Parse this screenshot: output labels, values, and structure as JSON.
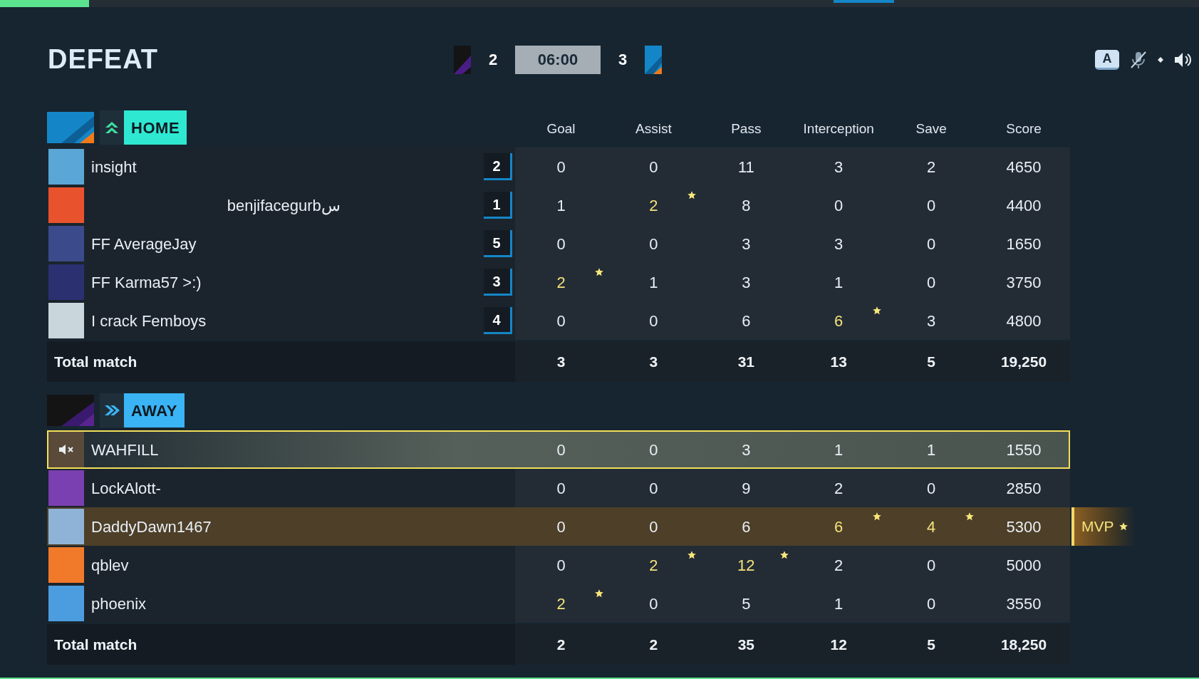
{
  "result": "DEFEAT",
  "scoreboard": {
    "left_score": "2",
    "timer": "06:00",
    "right_score": "3"
  },
  "keycap": "A",
  "columns": [
    "Goal",
    "Assist",
    "Pass",
    "Interception",
    "Save",
    "Score"
  ],
  "teams": [
    {
      "kind": "home",
      "label": "HOME",
      "players": [
        {
          "name": "insight",
          "name_centered": false,
          "badge": "2",
          "muted": false,
          "selected": false,
          "mvp": false,
          "stats": [
            {
              "value": "0",
              "best": false
            },
            {
              "value": "0",
              "best": false
            },
            {
              "value": "11",
              "best": false
            },
            {
              "value": "3",
              "best": false
            },
            {
              "value": "2",
              "best": false
            },
            {
              "value": "4650",
              "best": false
            }
          ]
        },
        {
          "name": "benjifacegurbس",
          "name_centered": true,
          "badge": "1",
          "muted": false,
          "selected": false,
          "mvp": false,
          "stats": [
            {
              "value": "1",
              "best": false
            },
            {
              "value": "2",
              "best": true
            },
            {
              "value": "8",
              "best": false
            },
            {
              "value": "0",
              "best": false
            },
            {
              "value": "0",
              "best": false
            },
            {
              "value": "4400",
              "best": false
            }
          ]
        },
        {
          "name": "FF AverageJay",
          "name_centered": false,
          "badge": "5",
          "muted": false,
          "selected": false,
          "mvp": false,
          "stats": [
            {
              "value": "0",
              "best": false
            },
            {
              "value": "0",
              "best": false
            },
            {
              "value": "3",
              "best": false
            },
            {
              "value": "3",
              "best": false
            },
            {
              "value": "0",
              "best": false
            },
            {
              "value": "1650",
              "best": false
            }
          ]
        },
        {
          "name": "FF Karma57 >:)",
          "name_centered": false,
          "badge": "3",
          "muted": false,
          "selected": false,
          "mvp": false,
          "stats": [
            {
              "value": "2",
              "best": true
            },
            {
              "value": "1",
              "best": false
            },
            {
              "value": "3",
              "best": false
            },
            {
              "value": "1",
              "best": false
            },
            {
              "value": "0",
              "best": false
            },
            {
              "value": "3750",
              "best": false
            }
          ]
        },
        {
          "name": "I crack Femboys",
          "name_centered": false,
          "badge": "4",
          "muted": false,
          "selected": false,
          "mvp": false,
          "stats": [
            {
              "value": "0",
              "best": false
            },
            {
              "value": "0",
              "best": false
            },
            {
              "value": "6",
              "best": false
            },
            {
              "value": "6",
              "best": true
            },
            {
              "value": "3",
              "best": false
            },
            {
              "value": "4800",
              "best": false
            }
          ]
        }
      ],
      "total_label": "Total match",
      "totals": [
        "3",
        "3",
        "31",
        "13",
        "5",
        "19,250"
      ]
    },
    {
      "kind": "away",
      "label": "AWAY",
      "players": [
        {
          "name": "WAHFILL",
          "name_centered": false,
          "muted": true,
          "selected": true,
          "mvp": false,
          "stats": [
            {
              "value": "0",
              "best": false
            },
            {
              "value": "0",
              "best": false
            },
            {
              "value": "3",
              "best": false
            },
            {
              "value": "1",
              "best": false
            },
            {
              "value": "1",
              "best": false
            },
            {
              "value": "1550",
              "best": false
            }
          ]
        },
        {
          "name": "LockAlott-",
          "name_centered": false,
          "muted": false,
          "selected": false,
          "mvp": false,
          "stats": [
            {
              "value": "0",
              "best": false
            },
            {
              "value": "0",
              "best": false
            },
            {
              "value": "9",
              "best": false
            },
            {
              "value": "2",
              "best": false
            },
            {
              "value": "0",
              "best": false
            },
            {
              "value": "2850",
              "best": false
            }
          ]
        },
        {
          "name": "DaddyDawn1467",
          "name_centered": false,
          "muted": false,
          "selected": false,
          "mvp": true,
          "mvp_label": "MVP",
          "stats": [
            {
              "value": "0",
              "best": false
            },
            {
              "value": "0",
              "best": false
            },
            {
              "value": "6",
              "best": false
            },
            {
              "value": "6",
              "best": true
            },
            {
              "value": "4",
              "best": true
            },
            {
              "value": "5300",
              "best": false
            }
          ]
        },
        {
          "name": "qblev",
          "name_centered": false,
          "muted": false,
          "selected": false,
          "mvp": false,
          "stats": [
            {
              "value": "0",
              "best": false
            },
            {
              "value": "2",
              "best": true
            },
            {
              "value": "12",
              "best": true
            },
            {
              "value": "2",
              "best": false
            },
            {
              "value": "0",
              "best": false
            },
            {
              "value": "5000",
              "best": false
            }
          ]
        },
        {
          "name": "phoenix",
          "name_centered": false,
          "muted": false,
          "selected": false,
          "mvp": false,
          "stats": [
            {
              "value": "2",
              "best": true
            },
            {
              "value": "0",
              "best": false
            },
            {
              "value": "5",
              "best": false
            },
            {
              "value": "1",
              "best": false
            },
            {
              "value": "0",
              "best": false
            },
            {
              "value": "3550",
              "best": false
            }
          ]
        }
      ],
      "total_label": "Total match",
      "totals": [
        "2",
        "2",
        "35",
        "12",
        "5",
        "18,250"
      ]
    }
  ]
}
